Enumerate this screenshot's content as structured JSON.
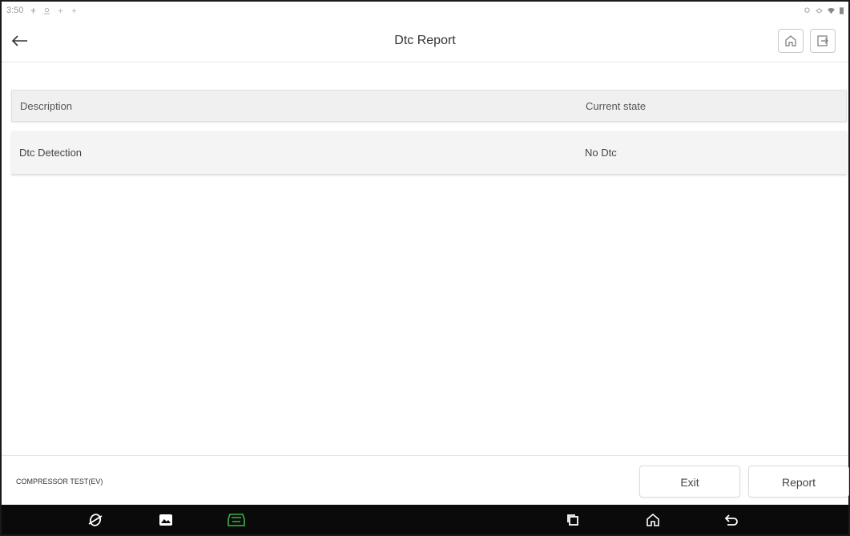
{
  "status_bar": {
    "time": "3:50",
    "left_icons": [
      "usb-icon",
      "location-icon",
      "notification-icon",
      "notification-icon"
    ],
    "right_icons": [
      "location-icon",
      "data-icon",
      "wifi-icon",
      "battery-icon"
    ]
  },
  "header": {
    "title": "Dtc Report",
    "back_icon": "arrow-left-icon",
    "home_icon": "home-icon",
    "exit_icon": "exit-icon"
  },
  "table": {
    "columns": [
      "Description",
      "Current state"
    ],
    "rows": [
      {
        "description": "Dtc Detection",
        "state": "No Dtc"
      }
    ]
  },
  "footer": {
    "function_name": "COMPRESSOR TEST(EV)",
    "exit_label": "Exit",
    "report_label": "Report"
  },
  "nav_bar": {
    "icons": [
      "browser-icon",
      "gallery-icon",
      "vci-icon",
      "recents-icon",
      "home-icon",
      "back-icon"
    ],
    "accent": "#3bb54a"
  },
  "colors": {
    "header_row_bg": "#f0f0f0",
    "row_bg": "#f4f4f4",
    "nav_bg": "#0a0a0a"
  }
}
